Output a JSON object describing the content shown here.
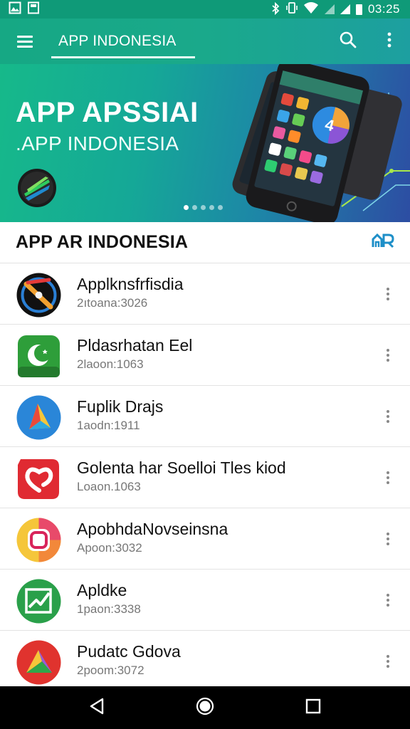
{
  "status_bar": {
    "time": "03:25",
    "left_icons": [
      "gallery-icon",
      "notification-icon"
    ],
    "right_icons": [
      "bluetooth-icon",
      "vibrate-icon",
      "wifi-icon",
      "signal-icon",
      "signal-icon",
      "battery-icon"
    ]
  },
  "toolbar": {
    "title": "APP INDONESIA",
    "menu_icon": "hamburger-menu-icon",
    "search_icon": "search-icon",
    "more_icon": "more-vert-icon"
  },
  "banner": {
    "title": "APP APSSIAI",
    "subtitle": ".APP INDONESIA",
    "slide_count": 5,
    "active_slide": 1
  },
  "section": {
    "title": "APP AR INDONESIA",
    "action_icon": "store-icon"
  },
  "apps": [
    {
      "name": "Applknsfrfisdia",
      "meta": "2ıtoana:3026",
      "icon": "compass-icon"
    },
    {
      "name": "Pldasrhatan Eel",
      "meta": "2laoon:1063",
      "icon": "crescent-icon"
    },
    {
      "name": "Fuplik Drajs",
      "meta": "1aodn:1911",
      "icon": "play-arrow-icon"
    },
    {
      "name": "Golenta har Soelloi Tles kiod",
      "meta": "Loaon.1063",
      "icon": "heart-icon"
    },
    {
      "name": "ApobhdaNovseinsna",
      "meta": "Apoon:3032",
      "icon": "camera-icon"
    },
    {
      "name": "Apldke",
      "meta": "1paon:3338",
      "icon": "chart-icon"
    },
    {
      "name": "Pudatc Gdova",
      "meta": "2poom:3072",
      "icon": "triangle-logo-icon"
    }
  ],
  "nav": {
    "back_icon": "back-icon",
    "home_icon": "home-icon",
    "recents_icon": "recents-icon"
  },
  "colors": {
    "primary": "#16a884",
    "status_bar": "#0f9a78",
    "accent": "#1e8fc8"
  }
}
